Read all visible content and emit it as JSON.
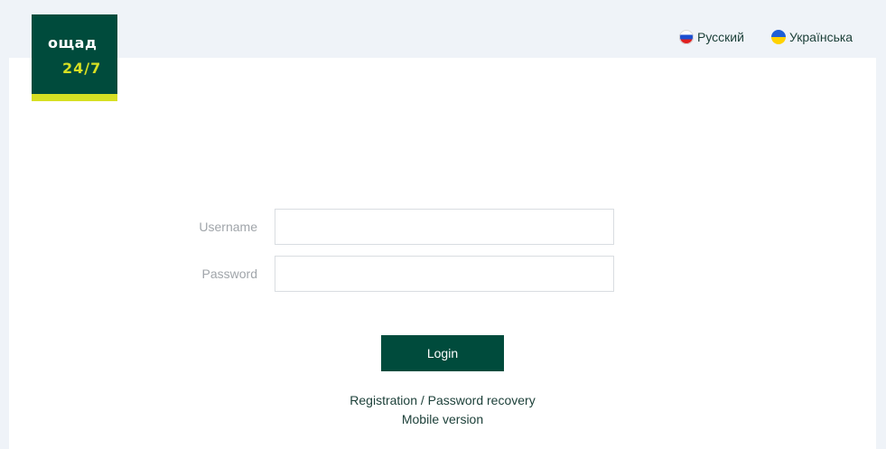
{
  "brand": {
    "logo_word": "ощад",
    "logo_hours": "24/7",
    "colors": {
      "primary": "#004b3c",
      "accent": "#d7df23",
      "background": "#eff3f8"
    }
  },
  "languages": [
    {
      "label": "Русский",
      "flag_icon": "russia-flag-icon"
    },
    {
      "label": "Українська",
      "flag_icon": "ukraine-flag-icon"
    }
  ],
  "form": {
    "username_label": "Username",
    "username_value": "",
    "password_label": "Password",
    "password_value": "",
    "login_label": "Login"
  },
  "links": {
    "registration": "Registration",
    "separator": "/",
    "password_recovery": "Password recovery",
    "mobile_version": "Mobile version"
  }
}
